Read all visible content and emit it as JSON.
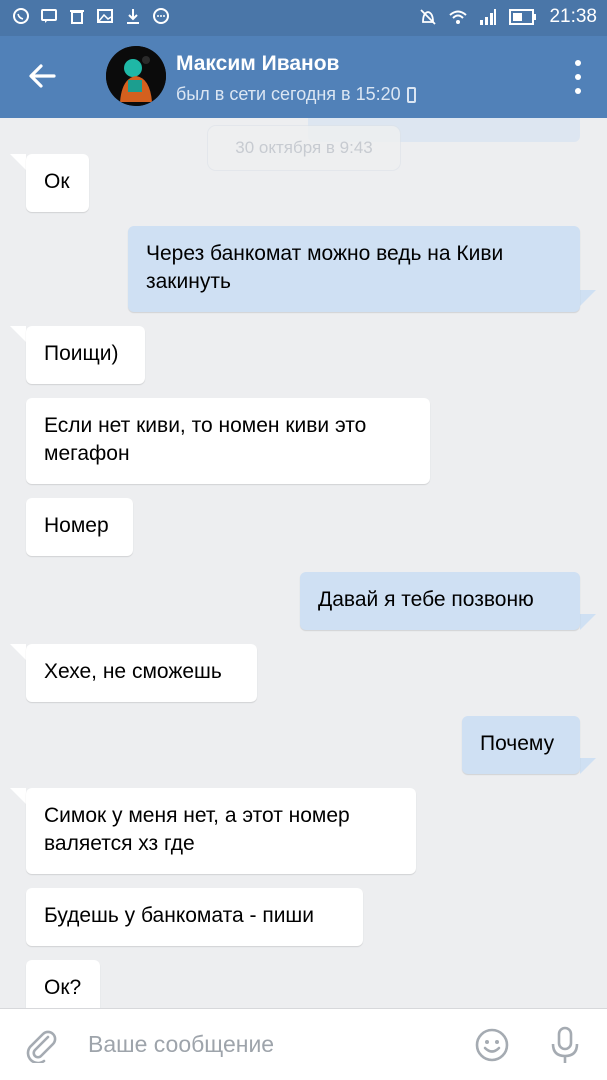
{
  "status_bar": {
    "time": "21:38"
  },
  "header": {
    "name": "Максим Иванов",
    "last_seen": "был в сети сегодня в 15:20"
  },
  "chat": {
    "date_chip": "30 октября в 9:43",
    "messages": [
      {
        "direction": "in",
        "text": "Ок"
      },
      {
        "direction": "out",
        "text": "Через банкомат можно ведь на Киви\nзакинуть"
      },
      {
        "direction": "in",
        "text": "Поищи)"
      },
      {
        "direction": "in",
        "text": "Если нет киви, то номен киви это\nмегафон"
      },
      {
        "direction": "in",
        "text": "Номер"
      },
      {
        "direction": "out",
        "text": "Давай я тебе позвоню"
      },
      {
        "direction": "in",
        "text": "Хехе, не сможешь"
      },
      {
        "direction": "out",
        "text": "Почему"
      },
      {
        "direction": "in",
        "text": "Симок у меня нет, а этот  номер\nваляется хз где"
      },
      {
        "direction": "in",
        "text": "Будешь у банкомата - пиши"
      },
      {
        "direction": "in",
        "text": "Ок?"
      }
    ]
  },
  "input": {
    "placeholder": "Ваше сообщение"
  },
  "colors": {
    "header": "#5181b8",
    "status_bar": "#4a76a8",
    "outgoing_bubble": "#cfe0f3",
    "background": "#edeef0"
  }
}
